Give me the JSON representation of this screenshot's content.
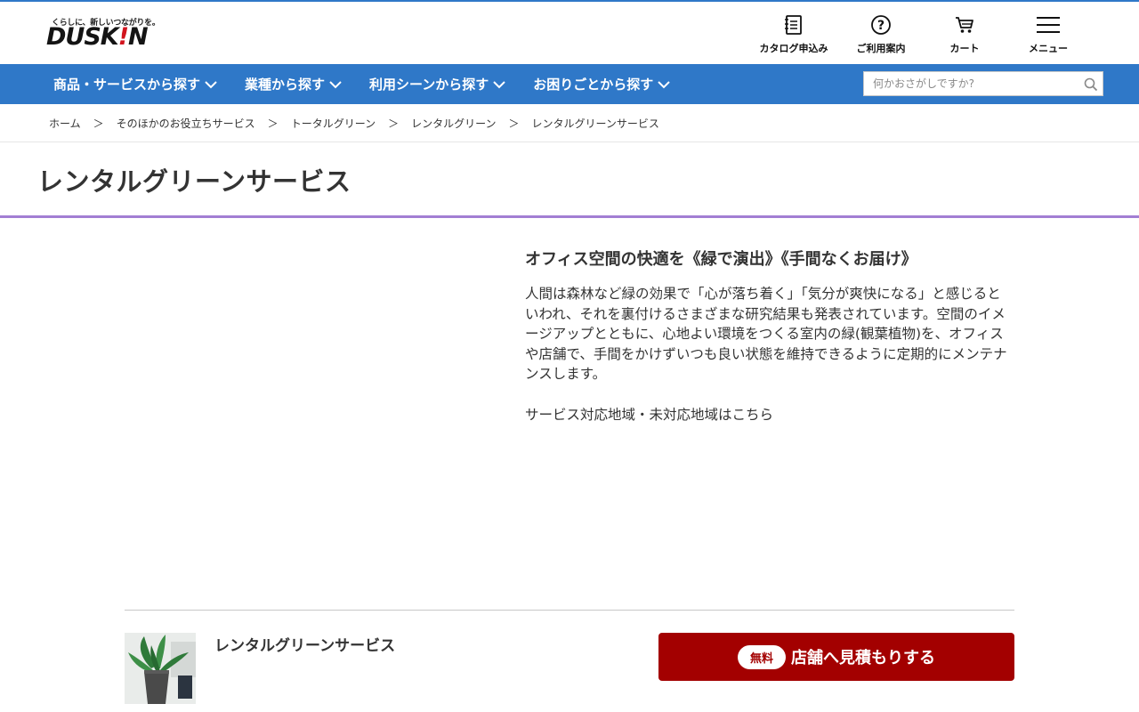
{
  "brand": {
    "tagline": "くらしに、新しいつながりを。",
    "name_main": "DUSK",
    "name_bang": "!",
    "name_end": "N"
  },
  "util_nav": [
    {
      "label": "カタログ申込み",
      "icon": "catalog-icon"
    },
    {
      "label": "ご利用案内",
      "icon": "help-circle-icon"
    },
    {
      "label": "カート",
      "icon": "cart-icon"
    },
    {
      "label": "メニュー",
      "icon": "hamburger-menu-icon"
    }
  ],
  "nav": {
    "items": [
      {
        "label": "商品・サービスから探す"
      },
      {
        "label": "業種から探す"
      },
      {
        "label": "利用シーンから探す"
      },
      {
        "label": "お困りごとから探す"
      }
    ],
    "search_placeholder": "何かおさがしですか?"
  },
  "breadcrumb": {
    "items": [
      "ホーム",
      "そのほかのお役立ちサービス",
      "トータルグリーン",
      "レンタルグリーン",
      "レンタルグリーンサービス"
    ],
    "separator": "＞"
  },
  "page": {
    "title": "レンタルグリーンサービス",
    "lead": "オフィス空間の快適を《緑で演出》《手間なくお届け》",
    "body": "人間は森林など緑の効果で「心が落ち着く」「気分が爽快になる」と感じるといわれ、それを裏付けるさまざまな研究結果も発表されています。空間のイメージアップとともに、心地よい環境をつくる室内の緑(観葉植物)を、オフィスや店舗で、手間をかけずいつも良い状態を維持できるように定期的にメンテナンスします。",
    "area_link": "サービス対応地域・未対応地域はこちら"
  },
  "footer_bar": {
    "product_name": "レンタルグリーンサービス",
    "badge": "無料",
    "button_label": "店舗へ見積もりする"
  },
  "colors": {
    "nav_blue": "#2f78c8",
    "title_rule": "#a27ed3",
    "cta_red": "#a30000"
  }
}
